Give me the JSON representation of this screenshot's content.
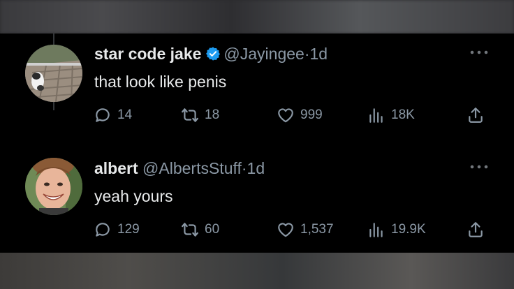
{
  "tweets": [
    {
      "name": "star code jake",
      "verified": true,
      "handle": "@Jayingee",
      "separator": "·",
      "time": "1d",
      "text": "that look like penis",
      "replies": "14",
      "retweets": "18",
      "likes": "999",
      "views": "18K"
    },
    {
      "name": "albert",
      "verified": false,
      "handle": "@AlbertsStuff",
      "separator": "·",
      "time": "1d",
      "text": "yeah yours",
      "replies": "129",
      "retweets": "60",
      "likes": "1,537",
      "views": "19.9K"
    }
  ],
  "colors": {
    "background": "#000000",
    "text": "#e7e9ea",
    "secondary": "#8b98a5",
    "verified": "#1d9bf0",
    "thread_line": "#333639"
  },
  "icons": [
    "reply-icon",
    "retweet-icon",
    "like-icon",
    "views-icon",
    "share-icon",
    "more-icon",
    "verified-badge-icon"
  ]
}
